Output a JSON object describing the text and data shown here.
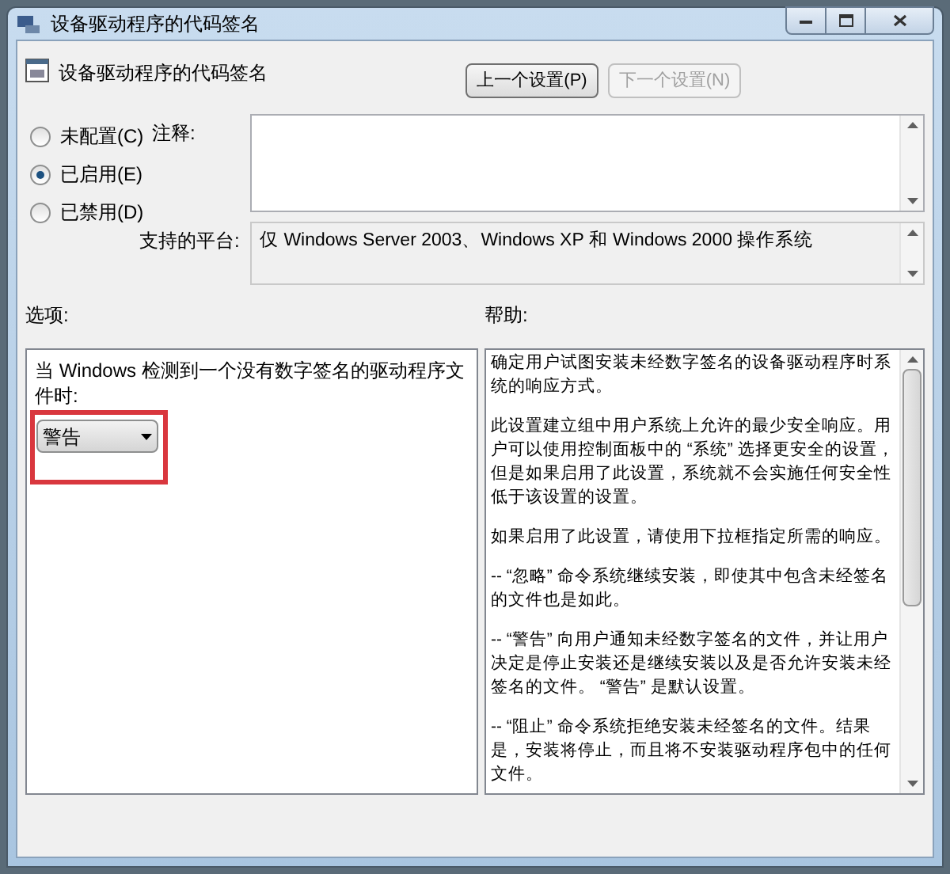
{
  "window": {
    "title": "设备驱动程序的代码签名"
  },
  "header": {
    "title": "设备驱动程序的代码签名"
  },
  "nav_buttons": [
    {
      "label": "上一个设置(P)",
      "disabled": false
    },
    {
      "label": "下一个设置(N)",
      "disabled": true
    }
  ],
  "states": [
    {
      "label": "未配置(C)",
      "selected": false
    },
    {
      "label": "已启用(E)",
      "selected": true
    },
    {
      "label": "已禁用(D)",
      "selected": false
    }
  ],
  "comment": {
    "label": "注释:"
  },
  "platform": {
    "label": "支持的平台:",
    "value": "仅 Windows Server 2003、Windows XP 和 Windows 2000 操作系统"
  },
  "options": {
    "label": "选项:",
    "prompt": "当 Windows 检测到一个没有数字签名的驱动程序文件时:",
    "dropdown": {
      "value": "警告",
      "highlighted": true
    }
  },
  "help": {
    "label": "帮助:",
    "paragraphs": [
      "确定用户试图安装未经数字签名的设备驱动程序时系统的响应方式。",
      "此设置建立组中用户系统上允许的最少安全响应。用户可以使用控制面板中的 “系统” 选择更安全的设置，但是如果启用了此设置，系统就不会实施任何安全性低于该设置的设置。",
      "如果启用了此设置，请使用下拉框指定所需的响应。",
      "-- “忽略” 命令系统继续安装，即使其中包含未经签名的文件也是如此。",
      "-- “警告” 向用户通知未经数字签名的文件，并让用户决定是停止安装还是继续安装以及是否允许安装未经签名的文件。 “警告” 是默认设置。",
      "-- “阻止” 命令系统拒绝安装未经签名的文件。结果是，安装将停止，而且将不安装驱动程序包中的任何文件。"
    ]
  }
}
